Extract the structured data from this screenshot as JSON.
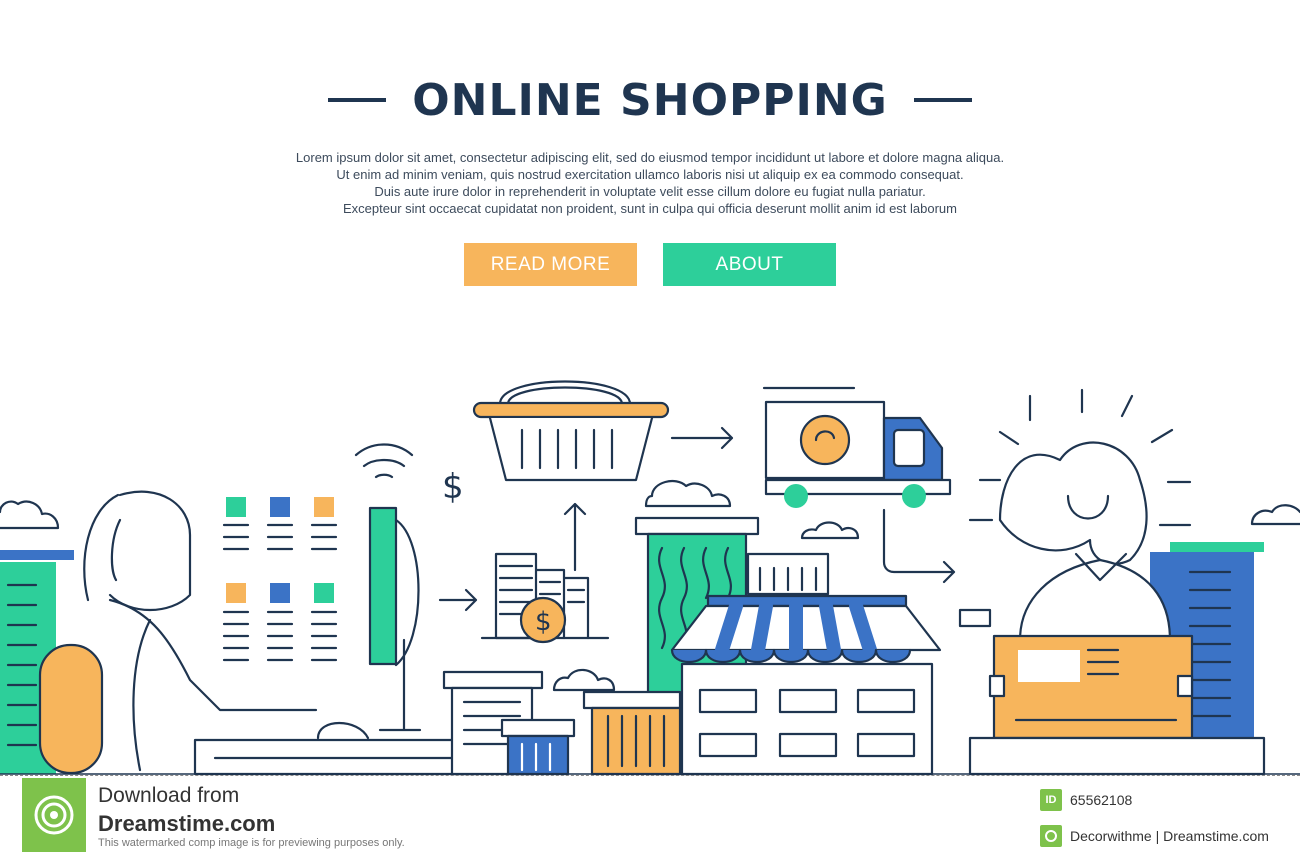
{
  "header": {
    "title": "ONLINE SHOPPING",
    "paragraph": [
      "Lorem ipsum dolor sit amet, consectetur adipiscing elit, sed do eiusmod tempor incididunt ut labore et dolore magna aliqua.",
      "Ut enim ad minim veniam, quis nostrud exercitation ullamco laboris nisi ut aliquip ex ea commodo consequat.",
      "Duis aute irure dolor in reprehenderit in voluptate velit esse cillum dolore eu fugiat nulla pariatur.",
      "Excepteur sint occaecat cupidatat non proident, sunt in culpa qui officia deserunt mollit anim id est laborum"
    ],
    "buttons": {
      "read_more": "READ MORE",
      "about": "ABOUT"
    }
  },
  "illustration": {
    "currency_symbol": "$",
    "icons": [
      "basket-icon",
      "delivery-truck-icon",
      "wifi-icon",
      "computer-monitor-icon",
      "coin-stack-icon",
      "shop-awning-icon",
      "parcel-box-icon",
      "cloud-icon",
      "arrow-icon"
    ]
  },
  "colors": {
    "navy": "#1f3550",
    "orange": "#f7b55c",
    "green": "#2dcf9a",
    "blue": "#3b73c6",
    "dreamstime_green": "#7ec24b"
  },
  "footer": {
    "download_label": "Download from",
    "site": "Dreamstime.com",
    "notice": "This watermarked comp image is for previewing purposes only.",
    "id_badge": "ID",
    "image_id": "65562108",
    "credit": "Decorwithme | Dreamstime.com"
  }
}
